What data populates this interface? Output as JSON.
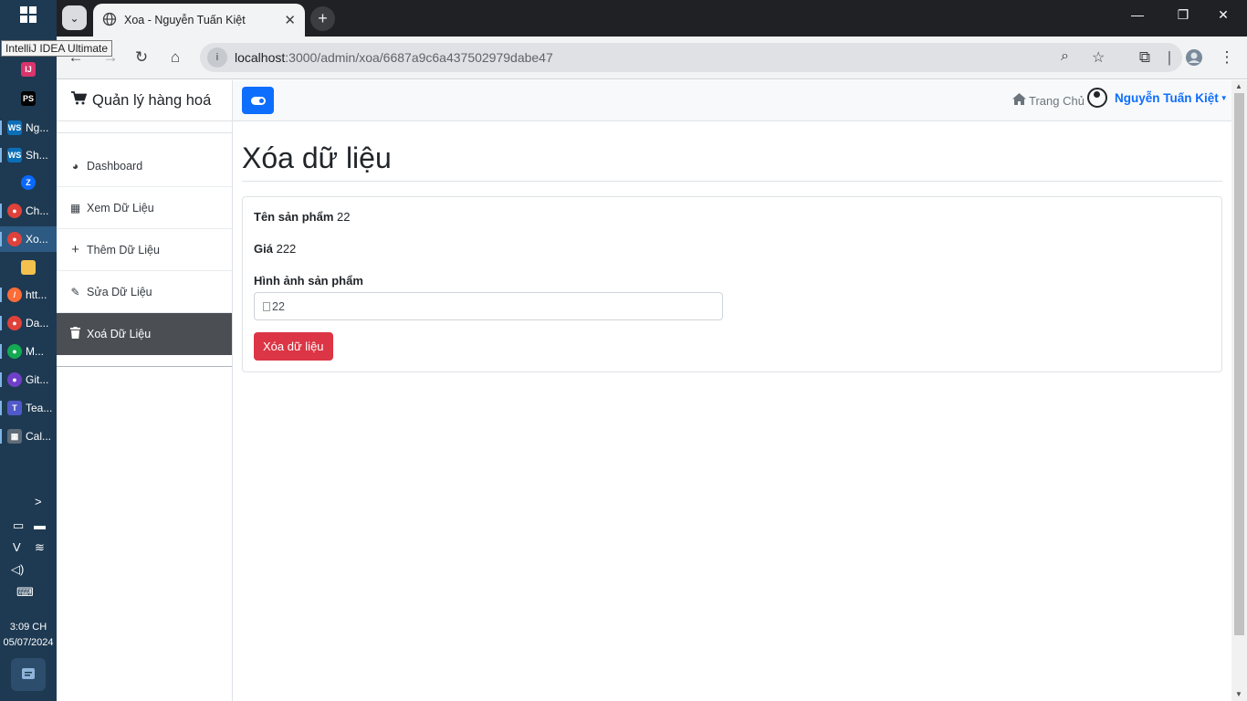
{
  "taskbar": {
    "tooltip": "IntelliJ IDEA Ultimate",
    "apps": [
      {
        "label": "Ng..."
      },
      {
        "label": "Sh..."
      },
      {
        "label": "Ch..."
      },
      {
        "label": "Xo..."
      },
      {
        "label": "htt..."
      },
      {
        "label": "Da..."
      },
      {
        "label": "M..."
      },
      {
        "label": "Git..."
      },
      {
        "label": "Tea..."
      },
      {
        "label": "Cal..."
      }
    ],
    "time": "3:09 CH",
    "date": "05/07/2024"
  },
  "browser": {
    "tab_title": "Xoa - Nguyễn Tuấn Kiệt",
    "url_host": "localhost",
    "url_path": ":3000/admin/xoa/6687a9c6a437502979dabe47"
  },
  "app": {
    "brand": "Quản lý hàng hoá",
    "nav": [
      {
        "label": "Dashboard",
        "icon": "dashboard-icon"
      },
      {
        "label": "Xem Dữ Liệu",
        "icon": "table-icon"
      },
      {
        "label": "Thêm Dữ Liệu",
        "icon": "plus-icon"
      },
      {
        "label": "Sửa Dữ Liệu",
        "icon": "pencil-icon"
      },
      {
        "label": "Xoá Dữ Liệu",
        "icon": "trash-icon"
      }
    ],
    "home_link": "Trang Chủ",
    "user_name": "Nguyễn Tuấn Kiệt",
    "colors": {
      "primary": "#0d6efd",
      "danger": "#dc3545",
      "sidebar_active": "#4b4f54"
    }
  },
  "main": {
    "title": "Xóa dữ liệu",
    "product_name_label": "Tên sản phẩm",
    "product_name_value": "22",
    "price_label": "Giá",
    "price_value": "222",
    "image_label": "Hình ảnh sản phẩm",
    "image_alt": "22",
    "delete_button": "Xóa dữ liệu"
  }
}
